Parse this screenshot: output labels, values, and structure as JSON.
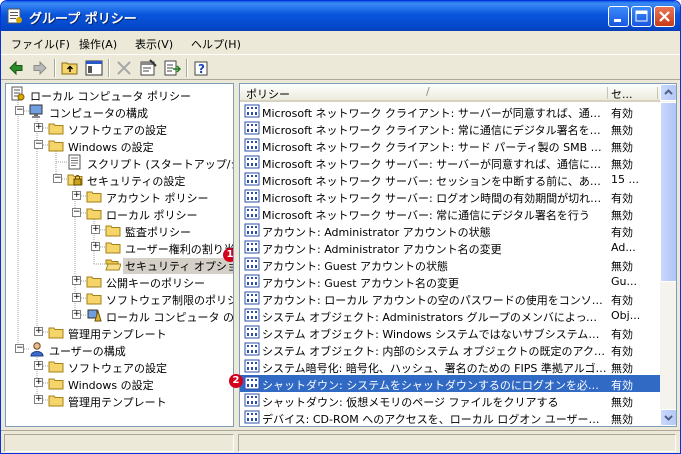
{
  "window": {
    "title": "グループ ポリシー"
  },
  "menu": {
    "file": "ファイル(F)",
    "action": "操作(A)",
    "view": "表示(V)",
    "help": "ヘルプ(H)"
  },
  "toolbar": {
    "icons": [
      "back-arrow-icon",
      "forward-arrow-icon",
      "up-folder-icon",
      "show-tree-icon",
      "delete-icon",
      "properties-icon",
      "export-list-icon",
      "help-icon"
    ]
  },
  "tree": {
    "items": [
      {
        "label": "ローカル コンピュータ ポリシー",
        "icon": "policy-icon",
        "level": 0,
        "expander": ""
      },
      {
        "label": "コンピュータの構成",
        "icon": "computer-icon",
        "level": 1,
        "expander": "−"
      },
      {
        "label": "ソフトウェアの設定",
        "icon": "folder-icon",
        "level": 2,
        "expander": "+"
      },
      {
        "label": "Windows の設定",
        "icon": "folder-icon",
        "level": 2,
        "expander": "−"
      },
      {
        "label": "スクリプト (スタートアップ/シャットダ",
        "icon": "script-icon",
        "level": 3,
        "expander": ""
      },
      {
        "label": "セキュリティの設定",
        "icon": "security-icon",
        "level": 3,
        "expander": "−"
      },
      {
        "label": "アカウント ポリシー",
        "icon": "folder-icon",
        "level": 4,
        "expander": "+"
      },
      {
        "label": "ローカル ポリシー",
        "icon": "folder-icon",
        "level": 4,
        "expander": "−"
      },
      {
        "label": "監査ポリシー",
        "icon": "folder-icon",
        "level": 5,
        "expander": "+"
      },
      {
        "label": "ユーザー権利の割り当て",
        "icon": "folder-icon",
        "level": 5,
        "expander": "+"
      },
      {
        "label": "セキュリティ オプション",
        "icon": "folder-open-icon",
        "level": 5,
        "expander": "",
        "selected": true
      },
      {
        "label": "公開キーのポリシー",
        "icon": "folder-icon",
        "level": 4,
        "expander": "+"
      },
      {
        "label": "ソフトウェア制限のポリシー",
        "icon": "folder-icon",
        "level": 4,
        "expander": "+"
      },
      {
        "label": "ローカル コンピュータ の IP セ",
        "icon": "ip-security-icon",
        "level": 4,
        "expander": "+"
      },
      {
        "label": "管理用テンプレート",
        "icon": "folder-icon",
        "level": 2,
        "expander": "+"
      },
      {
        "label": "ユーザーの構成",
        "icon": "user-icon",
        "level": 1,
        "expander": "−"
      },
      {
        "label": "ソフトウェアの設定",
        "icon": "folder-icon",
        "level": 2,
        "expander": "+"
      },
      {
        "label": "Windows の設定",
        "icon": "folder-icon",
        "level": 2,
        "expander": "+"
      },
      {
        "label": "管理用テンプレート",
        "icon": "folder-icon",
        "level": 2,
        "expander": "+"
      }
    ]
  },
  "list": {
    "col_policy": "ポリシー",
    "sort_indicator": "/",
    "col_setting": "セ...",
    "rows": [
      {
        "policy": "Microsoft ネットワーク クライアント: サーバーが同意すれば、通信にデジ...",
        "setting": "有効"
      },
      {
        "policy": "Microsoft ネットワーク クライアント: 常に通信にデジタル署名を行う",
        "setting": "無効"
      },
      {
        "policy": "Microsoft ネットワーク クライアント: サード パーティ製の SMB サーバーへ...",
        "setting": "無効"
      },
      {
        "policy": "Microsoft ネットワーク サーバー: サーバーが同意すれば、通信にデジタ...",
        "setting": "無効"
      },
      {
        "policy": "Microsoft ネットワーク サーバー: セッションを中断する前に、ある一定の...",
        "setting": "15 ..."
      },
      {
        "policy": "Microsoft ネットワーク サーバー: ログオン時間の有効期間が切れるとク...",
        "setting": "有効"
      },
      {
        "policy": "Microsoft ネットワーク サーバー: 常に通信にデジタル署名を行う",
        "setting": "無効"
      },
      {
        "policy": "アカウント: Administrator アカウントの状態",
        "setting": "有効"
      },
      {
        "policy": "アカウント: Administrator アカウント名の変更",
        "setting": "Ad..."
      },
      {
        "policy": "アカウント: Guest アカウントの状態",
        "setting": "無効"
      },
      {
        "policy": "アカウント: Guest アカウント名の変更",
        "setting": "Gu..."
      },
      {
        "policy": "アカウント: ローカル アカウントの空のパスワードの使用をコンソール ログオ...",
        "setting": "有効"
      },
      {
        "policy": "システム オブジェクト: Administrators グループのメンバによって作成され...",
        "setting": "Obj..."
      },
      {
        "policy": "システム オブジェクト: Windows システムではないサブシステムのための大...",
        "setting": "有効"
      },
      {
        "policy": "システム オブジェクト: 内部のシステム オブジェクトの既定のアクセス許可...",
        "setting": "有効"
      },
      {
        "policy": "システム暗号化: 暗号化、ハッシュ、署名のための FIPS 準拠アルゴリズ...",
        "setting": "無効"
      },
      {
        "policy": "シャットダウン: システムをシャットダウンするのにログオンを必要としない",
        "setting": "有効",
        "selected": true
      },
      {
        "policy": "シャットダウン: 仮想メモリのページ ファイルをクリアする",
        "setting": "無効"
      },
      {
        "policy": "デバイス: CD-ROM へのアクセスを、ローカル ログオン ユーザーだけに制...",
        "setting": "無効"
      }
    ]
  },
  "annotations": {
    "badge1": "1",
    "badge2": "2"
  },
  "colors": {
    "title_bar": "#0855dd",
    "selection": "#316ac5",
    "badge": "#d4001c"
  }
}
